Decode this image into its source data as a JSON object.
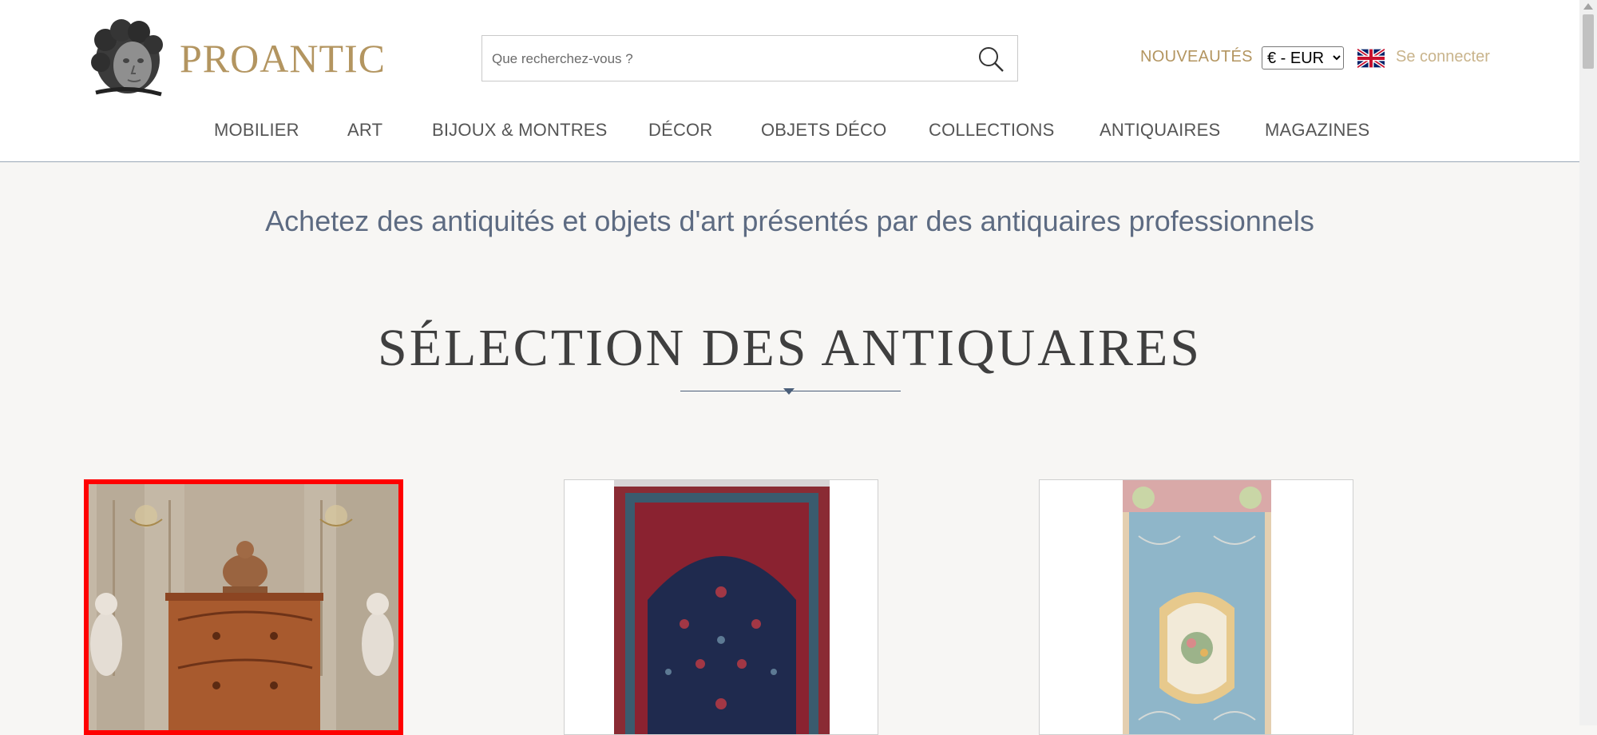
{
  "header": {
    "logo_text": "PROANTIC",
    "search_placeholder": "Que recherchez-vous ?",
    "nouveautes": "NOUVEAUTÉS",
    "currency": "€ - EUR",
    "login": "Se connecter"
  },
  "nav": {
    "items": [
      "MOBILIER",
      "ART",
      "BIJOUX & MONTRES",
      "DÉCOR",
      "OBJETS DÉCO",
      "COLLECTIONS",
      "ANTIQUAIRES",
      "MAGAZINES"
    ]
  },
  "main": {
    "tagline": "Achetez des antiquités et objets d'art présentés par des antiquaires professionnels",
    "section_title": "SÉLECTION DES ANTIQUAIRES"
  },
  "colors": {
    "brand_gold": "#b39560",
    "accent_blue": "#5d6b82",
    "selection_red": "#ff0000"
  },
  "icons": [
    "search-icon",
    "uk-flag-icon",
    "chevron-down-icon"
  ]
}
